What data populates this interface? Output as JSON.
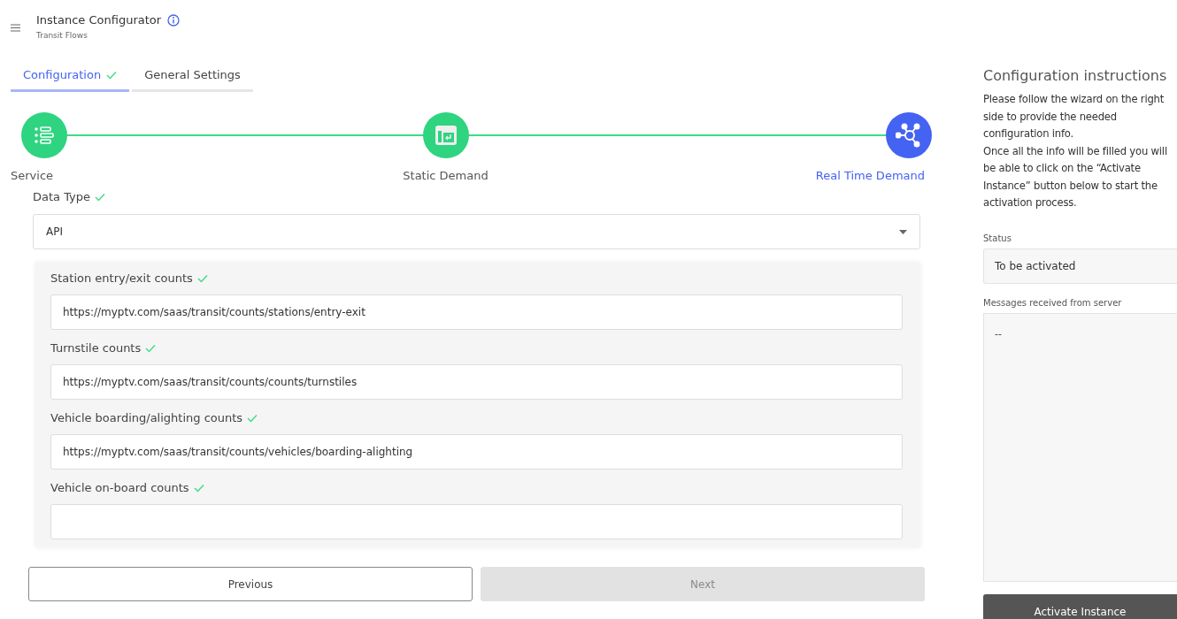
{
  "header": {
    "title": "Instance Configurator",
    "subtitle": "Transit Flows"
  },
  "tabs": [
    {
      "label": "Configuration",
      "selected": true,
      "checked": true
    },
    {
      "label": "General Settings",
      "selected": false,
      "checked": false
    }
  ],
  "steps": [
    {
      "label": "Service",
      "selected": false,
      "kind": "list"
    },
    {
      "label": "Static Demand",
      "selected": false,
      "kind": "table"
    },
    {
      "label": "Real Time Demand",
      "selected": true,
      "kind": "network"
    }
  ],
  "data_type": {
    "label": "Data Type",
    "checked": true,
    "value": "API"
  },
  "fields": [
    {
      "label": "Station entry/exit counts",
      "checked": true,
      "value": "https://myptv.com/saas/transit/counts/stations/entry-exit"
    },
    {
      "label": "Turnstile counts",
      "checked": true,
      "value": "https://myptv.com/saas/transit/counts/counts/turnstiles"
    },
    {
      "label": "Vehicle boarding/alighting counts",
      "checked": true,
      "value": "https://myptv.com/saas/transit/counts/vehicles/boarding-alighting"
    },
    {
      "label": "Vehicle on-board counts",
      "checked": true
    }
  ],
  "buttons": [
    {
      "label": "Previous",
      "disabled": false
    },
    {
      "label": "Next",
      "disabled": true
    }
  ],
  "instructions": {
    "title": "Configuration instructions",
    "lines": [
      "Please follow the wizard on the right side to provide the needed configuration info.",
      "Once all the info will be filled you will be able to click on the “Activate Instance” button below to start the activation process."
    ]
  },
  "status": {
    "label": "Status",
    "value": "To be activated"
  },
  "messages": {
    "label": "Messages received from server",
    "value": "--"
  },
  "activate_button": {
    "label": "Activate Instance",
    "disabled": false
  }
}
